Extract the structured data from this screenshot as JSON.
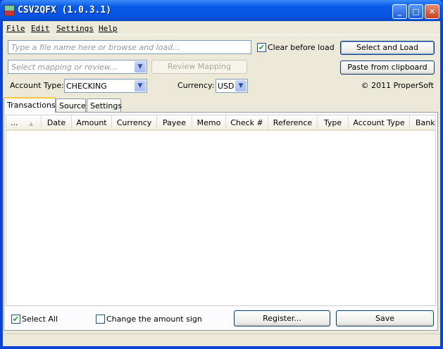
{
  "window": {
    "title": "CSV2QFX (1.0.3.1)",
    "minimize": "_",
    "maximize": "□",
    "close": "✕"
  },
  "menu": [
    "File",
    "Edit",
    "Settings",
    "Help"
  ],
  "file_input": {
    "placeholder": "Type a file name here or browse and load..."
  },
  "clear_before_load": {
    "label": "Clear before load",
    "checked": true
  },
  "buttons": {
    "select_and_load": "Select and Load",
    "paste": "Paste from clipboard",
    "review": "Review Mapping",
    "register": "Register...",
    "save": "Save"
  },
  "mapping": {
    "placeholder": "Select mapping or review..."
  },
  "account_type": {
    "label": "Account Type:",
    "value": "CHECKING"
  },
  "currency": {
    "label": "Currency:",
    "value": "USD"
  },
  "copyright": "© 2011 ProperSoft",
  "tabs": [
    "Transactions",
    "Source",
    "Settings"
  ],
  "active_tab": "Transactions",
  "columns": [
    "...",
    "Date",
    "Amount",
    "Currency",
    "Payee",
    "Memo",
    "Check #",
    "Reference",
    "Type",
    "Account Type",
    "Bank II"
  ],
  "rows": [],
  "select_all": {
    "label": "Select All",
    "checked": true
  },
  "change_sign": {
    "label": "Change the amount sign",
    "checked": false
  }
}
